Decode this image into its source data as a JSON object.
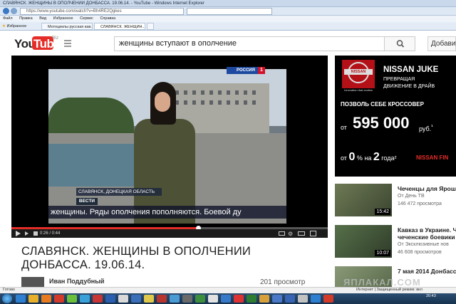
{
  "browser": {
    "title": "СЛАВЯНСК. ЖЕНЩИНЫ В ОПОЛЧЕНИИ ДОНБАССА. 19.06.14. - YouTube - Windows Internet Explorer",
    "url": "https://www.youtube.com/watch?v=Bh4RE2Qgkes",
    "menu": [
      "Файл",
      "Правка",
      "Вид",
      "Избранное",
      "Сервис",
      "Справка"
    ],
    "favorites_label": "Избранное",
    "tabs": [
      "Мотоциклы русская кав...",
      "СЛАВЯНСК. ЖЕНЩИН..."
    ]
  },
  "youtube": {
    "logo_you": "You",
    "logo_tube": "Tube",
    "logo_region": "RU",
    "search_value": "женщины вступают в ополчение",
    "upload_label": "Добавить"
  },
  "player": {
    "channel_bug": "РОССИЯ",
    "channel_bug_num": "1",
    "location_caption": "СЛАВЯНСК, ДОНЕЦКАЯ ОБЛАСТЬ",
    "vesti_label": "ВЕСТИ",
    "subtitle": "женщины. Ряды ополчения пополняются. Боевой ду",
    "time_display": "0:26 / 0:44",
    "progress": 0.59,
    "buffered": 0.6
  },
  "video": {
    "title": "СЛАВЯНСК. ЖЕНЩИНЫ В ОПОЛЧЕНИИ ДОНБАССА. 19.06.14.",
    "channel": "Иван Поддубный",
    "views": "201 просмотр"
  },
  "ad": {
    "brand": "NISSAN",
    "tagline": "Innovation that excites",
    "model": "NISSAN JUKE",
    "sub1": "ПРЕВРАЩАЯ",
    "sub2": "ДВИЖЕНИЕ В ДРАЙВ",
    "offer": "ПОЗВОЛЬ СЕБЕ КРОССОВЕР",
    "from": "от",
    "price": "595 000",
    "rub": "руб.",
    "rub_mark": "¹",
    "loan_from": "от",
    "loan_rate": "0",
    "loan_rate_mid": "% на",
    "loan_years": "2",
    "loan_years_unit": "года²",
    "loan_brand": "NISSAN FIN"
  },
  "related": [
    {
      "title": "Чеченцы для Ярош",
      "author": "От День ТВ",
      "views": "146 472 просмотра",
      "duration": "15:42"
    },
    {
      "title": "Кавказ в Украине. Ч",
      "line2": "чеченские боевики",
      "author": "От Эксклюзивные нов",
      "views": "46 608 просмотров",
      "duration": "10:07"
    },
    {
      "title": "7 мая 2014 Донбасс",
      "duration": ""
    }
  ],
  "status": {
    "left": "Готово",
    "zone": "Интернет | Защищенный режим: вкл"
  },
  "taskbar": {
    "time": "20:43"
  },
  "watermark": "ЯПЛАКАЛ.COM",
  "colors": {
    "youtube_red": "#e52d27",
    "ad_bg": "#000000",
    "progress_red": "#e52d27"
  }
}
